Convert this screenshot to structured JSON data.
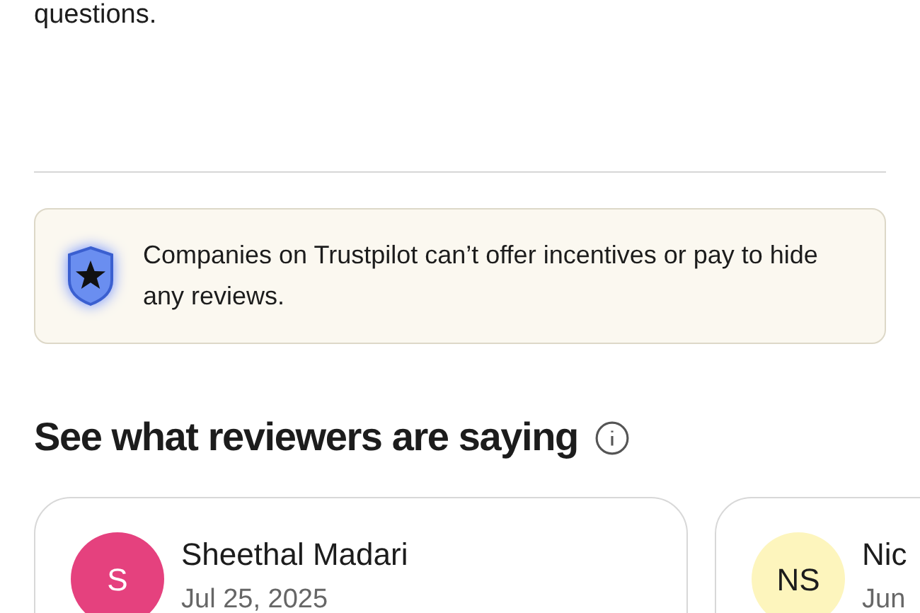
{
  "intro_tail": "questions.",
  "notice": {
    "text": "Companies on Trustpilot can’t offer incentives or pay to hide any reviews."
  },
  "section": {
    "title": "See what reviewers are saying"
  },
  "reviews": [
    {
      "initials": "S",
      "color": "#e5417e",
      "name": "Sheethal Madari",
      "date": "Jul 25, 2025"
    },
    {
      "initials": "NS",
      "color": "#fdf5bd",
      "name": "Nic",
      "date": "Jun"
    }
  ]
}
